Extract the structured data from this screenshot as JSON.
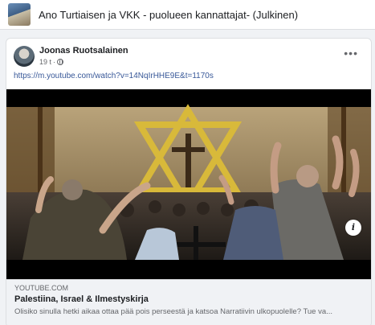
{
  "group": {
    "title": "Ano Turtiaisen ja VKK - puolueen kannattajat- (Julkinen)",
    "thumbnail_icon": "group-photo"
  },
  "post": {
    "author": "Joonas Ruotsalainen",
    "time": "19 t",
    "audience_icon": "globe-icon",
    "more_icon": "•••",
    "link_text": "https://m.youtube.com/watch?v=14NqIrHHE9E&t=1170s"
  },
  "preview": {
    "domain": "YOUTUBE.COM",
    "title": "Palestiina, Israel & Ilmestyskirja",
    "description": "Olisiko sinulla hetki aikaa ottaa pää pois perseestä ja katsoa Narratiivin ulkopuolelle? Tue va...",
    "info_icon": "i"
  },
  "colors": {
    "link": "#385898",
    "star": "#d8b93a",
    "card_bg": "#ffffff",
    "page_bg": "#f0f2f5"
  }
}
